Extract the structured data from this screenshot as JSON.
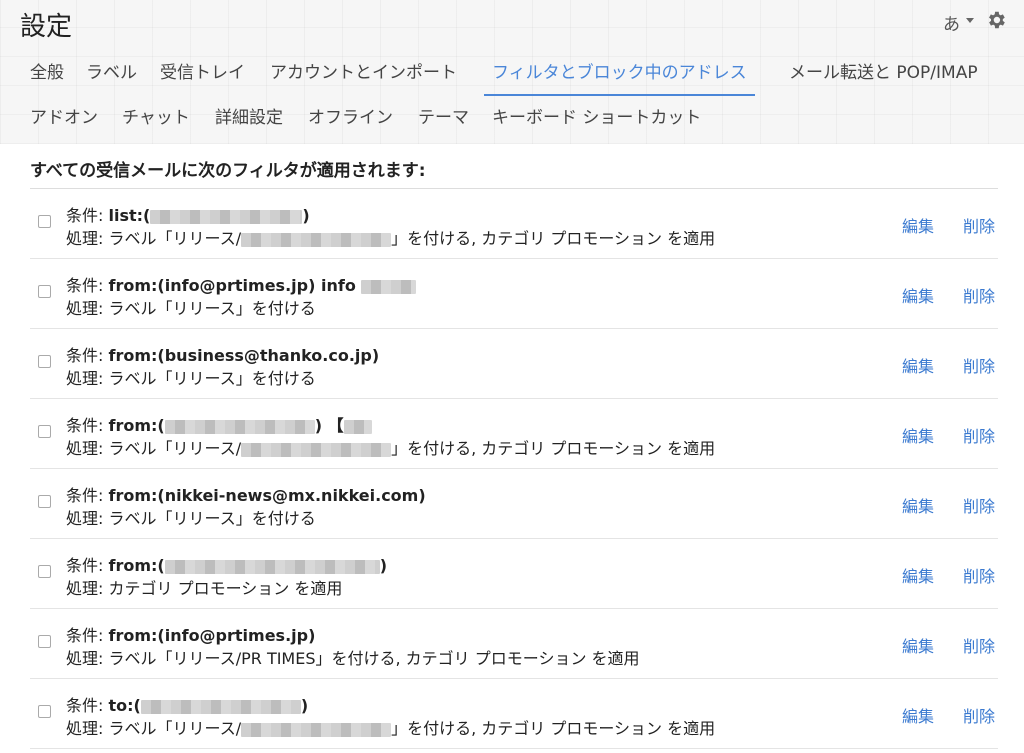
{
  "header": {
    "title": "設定",
    "ime_label": "あ"
  },
  "tabs_row1": [
    {
      "label": "全般"
    },
    {
      "label": "ラベル"
    },
    {
      "label": "受信トレイ"
    },
    {
      "label": "アカウントとインポート"
    },
    {
      "label": "フィルタとブロック中のアドレス",
      "active": true
    },
    {
      "label": "メール転送と POP/IMAP"
    }
  ],
  "tabs_row2": [
    {
      "label": "アドオン"
    },
    {
      "label": "チャット"
    },
    {
      "label": "詳細設定"
    },
    {
      "label": "オフライン"
    },
    {
      "label": "テーマ"
    },
    {
      "label": "キーボード ショートカット"
    }
  ],
  "filters": {
    "heading": "すべての受信メールに次のフィルタが適用されます:",
    "condition_label": "条件:",
    "action_label": "処理:",
    "edit_label": "編集",
    "delete_label": "削除",
    "items": [
      {
        "cond_a": "list:(",
        "cond_b": ")",
        "act_a": "ラベル「リリース/",
        "act_b": "」を付ける, カテゴリ プロモーション を適用"
      },
      {
        "cond_a": "from:(info@prtimes.jp) info",
        "cond_b": "",
        "act_a": "ラベル「リリース」を付ける",
        "act_b": ""
      },
      {
        "cond_a": "from:(business@thanko.co.jp)",
        "cond_b": "",
        "act_a": "ラベル「リリース」を付ける",
        "act_b": ""
      },
      {
        "cond_a": "from:(",
        "cond_b": ") 【",
        "act_a": "ラベル「リリース/",
        "act_b": "」を付ける, カテゴリ プロモーション を適用"
      },
      {
        "cond_a": "from:(nikkei-news@mx.nikkei.com)",
        "cond_b": "",
        "act_a": "ラベル「リリース」を付ける",
        "act_b": ""
      },
      {
        "cond_a": "from:(",
        "cond_b": ")",
        "act_a": "カテゴリ プロモーション を適用",
        "act_b": ""
      },
      {
        "cond_a": "from:(info@prtimes.jp)",
        "cond_b": "",
        "act_a": "ラベル「リリース/PR TIMES」を付ける, カテゴリ プロモーション を適用",
        "act_b": ""
      },
      {
        "cond_a": "to:(",
        "cond_b": ")",
        "act_a": "ラベル「リリース/",
        "act_b": "」を付ける, カテゴリ プロモーション を適用"
      }
    ]
  },
  "colors": {
    "accent": "#4a86d8",
    "link": "#3b7ad0"
  }
}
